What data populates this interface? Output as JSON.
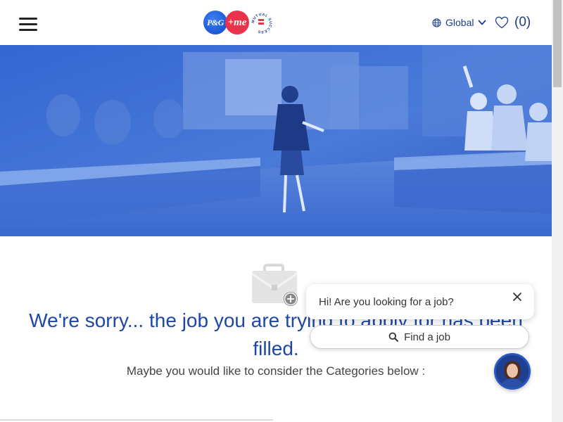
{
  "header": {
    "logo_pg": "P&G",
    "logo_me": "+me",
    "logo_ring": "MUTUAL SUCCESS",
    "region_label": "Global",
    "favorites_count": "(0)"
  },
  "main": {
    "sorry_text": "We're sorry... the job you are trying to apply for has been filled.",
    "maybe_text": "Maybe you would like to consider the Categories below :"
  },
  "chat": {
    "greeting": "Hi! Are you looking for a job?",
    "find_job_label": "Find a job"
  },
  "icons": {
    "menu": "hamburger-icon",
    "region": "globe-icon",
    "dropdown": "chevron-down-icon",
    "favorites": "heart-icon",
    "briefcase": "briefcase-icon",
    "close": "close-icon",
    "search": "search-icon"
  },
  "colors": {
    "brand_blue": "#1e47a8",
    "hero_blue": "#2f5fc8",
    "accent_red": "#e8334a",
    "nav_text": "#1e3c8c"
  }
}
